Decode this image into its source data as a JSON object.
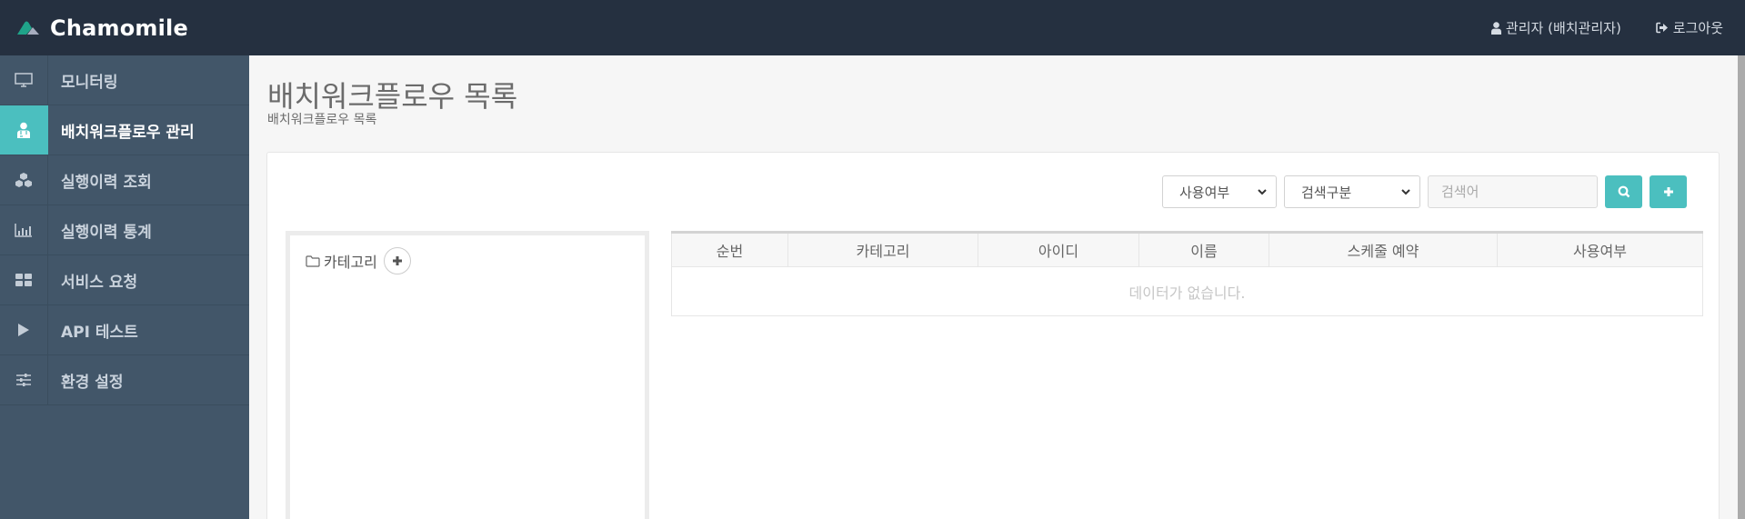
{
  "app": {
    "name": "Chamomile",
    "colors": {
      "topbar": "#253040",
      "sidebar": "#425669",
      "accent": "#4bbfbf"
    }
  },
  "header": {
    "user_icon": "user-icon",
    "user_label": "관리자 (배치관리자)",
    "logout_icon": "sign-out-icon",
    "logout_label": "로그아웃"
  },
  "sidebar": {
    "items": [
      {
        "icon": "monitor-icon",
        "label": "모니터링",
        "active": false
      },
      {
        "icon": "user-md-icon",
        "label": "배치워크플로우 관리",
        "active": true
      },
      {
        "icon": "cubes-icon",
        "label": "실행이력 조회",
        "active": false
      },
      {
        "icon": "bar-chart-icon",
        "label": "실행이력 통계",
        "active": false
      },
      {
        "icon": "th-large-icon",
        "label": "서비스 요청",
        "active": false
      },
      {
        "icon": "play-icon",
        "label": "API 테스트",
        "active": false
      },
      {
        "icon": "sliders-icon",
        "label": "환경 설정",
        "active": false
      }
    ]
  },
  "page": {
    "title": "배치워크플로우 목록",
    "subtitle": "배치워크플로우 목록"
  },
  "toolbar": {
    "use_select": "사용여부",
    "search_type_select": "검색구분",
    "search_placeholder": "검색어",
    "search_value": "",
    "search_button_icon": "search-icon",
    "add_button_icon": "plus-icon"
  },
  "category": {
    "icon": "folder-open-icon",
    "label": "카테고리",
    "add_icon": "plus-icon"
  },
  "table": {
    "columns": [
      "순번",
      "카테고리",
      "아이디",
      "이름",
      "스케줄 예약",
      "사용여부"
    ],
    "rows": [],
    "empty_message": "데이터가 없습니다."
  }
}
